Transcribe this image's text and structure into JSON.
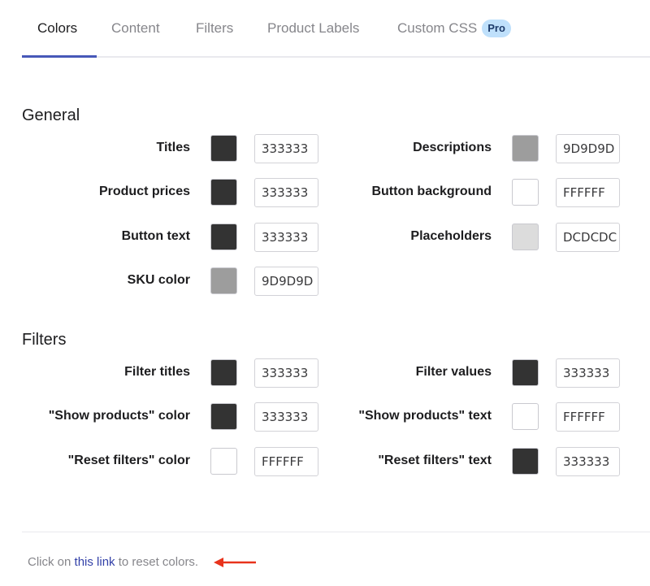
{
  "tabs": [
    {
      "label": "Colors",
      "active": true
    },
    {
      "label": "Content",
      "active": false
    },
    {
      "label": "Filters",
      "active": false
    },
    {
      "label": "Product Labels",
      "active": false
    },
    {
      "label": "Custom CSS",
      "active": false,
      "badge": "Pro"
    }
  ],
  "sections": {
    "general": {
      "title": "General",
      "fields": [
        {
          "label": "Titles",
          "value": "333333",
          "color": "#333333"
        },
        {
          "label": "Descriptions",
          "value": "9D9D9D",
          "color": "#9D9D9D"
        },
        {
          "label": "Product prices",
          "value": "333333",
          "color": "#333333"
        },
        {
          "label": "Button background",
          "value": "FFFFFF",
          "color": "#FFFFFF"
        },
        {
          "label": "Button text",
          "value": "333333",
          "color": "#333333"
        },
        {
          "label": "Placeholders",
          "value": "DCDCDC",
          "color": "#DCDCDC"
        },
        {
          "label": "SKU color",
          "value": "9D9D9D",
          "color": "#9D9D9D"
        }
      ]
    },
    "filters": {
      "title": "Filters",
      "fields": [
        {
          "label": "Filter titles",
          "value": "333333",
          "color": "#333333"
        },
        {
          "label": "Filter values",
          "value": "333333",
          "color": "#333333"
        },
        {
          "label": "\"Show products\" color",
          "value": "333333",
          "color": "#333333"
        },
        {
          "label": "\"Show products\" text",
          "value": "FFFFFF",
          "color": "#FFFFFF"
        },
        {
          "label": "\"Reset filters\" color",
          "value": "FFFFFF",
          "color": "#FFFFFF"
        },
        {
          "label": "\"Reset filters\" text",
          "value": "333333",
          "color": "#333333"
        }
      ]
    }
  },
  "footer": {
    "prefix": "Click on ",
    "link": "this link",
    "suffix": " to reset colors."
  },
  "annotation_arrow_color": "#e8331c"
}
